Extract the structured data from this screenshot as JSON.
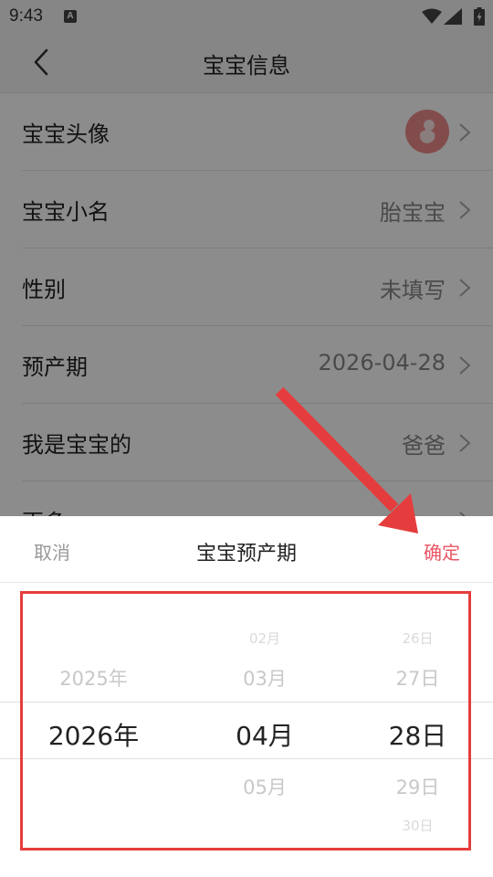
{
  "status_bar": {
    "time": "9:43",
    "notif_icon": "A"
  },
  "header": {
    "title": "宝宝信息"
  },
  "rows": [
    {
      "label": "宝宝头像",
      "value": ""
    },
    {
      "label": "宝宝小名",
      "value": "胎宝宝"
    },
    {
      "label": "性别",
      "value": "未填写"
    },
    {
      "label": "预产期",
      "value": "2026-04-28"
    },
    {
      "label": "我是宝宝的",
      "value": "爸爸"
    },
    {
      "label": "更多",
      "value": ""
    }
  ],
  "sheet": {
    "cancel": "取消",
    "title": "宝宝预产期",
    "confirm": "确定"
  },
  "picker": {
    "year": {
      "above": "2025年",
      "selected": "2026年"
    },
    "month": {
      "above2": "02月",
      "above1": "03月",
      "selected": "04月",
      "below1": "05月"
    },
    "day": {
      "above2": "26日",
      "above1": "27日",
      "selected": "28日",
      "below1": "29日",
      "below2": "30日"
    }
  },
  "colors": {
    "accent": "#ea5564",
    "annotation": "#e53d3d",
    "avatar": "#ee8a8a"
  }
}
